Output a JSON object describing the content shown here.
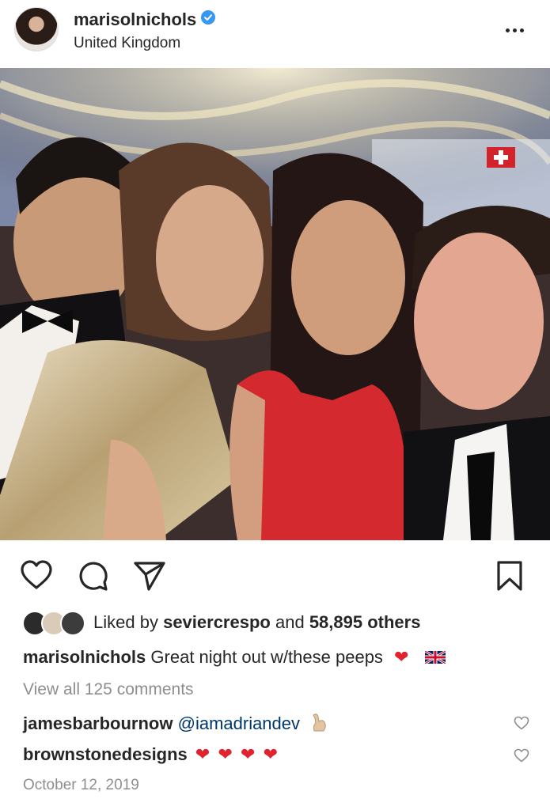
{
  "post": {
    "username": "marisolnichols",
    "location": "United Kingdom",
    "verified": true,
    "likes": {
      "prefix": "Liked by",
      "liker": "seviercrespo",
      "conjunction": "and",
      "others": "58,895 others"
    },
    "caption": {
      "author": "marisolnichols",
      "text": "Great night out w/these peeps"
    },
    "view_all_comments": "View all 125 comments",
    "comments": [
      {
        "author": "jamesbarbournow",
        "text": "@iamadriandev"
      },
      {
        "author": "brownstonedesigns",
        "text": ""
      }
    ],
    "date": "October 12, 2019"
  },
  "icons": {
    "like": "heart-icon",
    "comment": "comment-icon",
    "share": "paper-plane-icon",
    "save": "bookmark-icon",
    "more": "more-options-icon",
    "verified": "verified-badge-icon"
  },
  "colors": {
    "text": "#262626",
    "secondary": "#8e8e8e",
    "verified": "#3897f0",
    "mention": "#00376b",
    "heart": "#e0232e"
  }
}
